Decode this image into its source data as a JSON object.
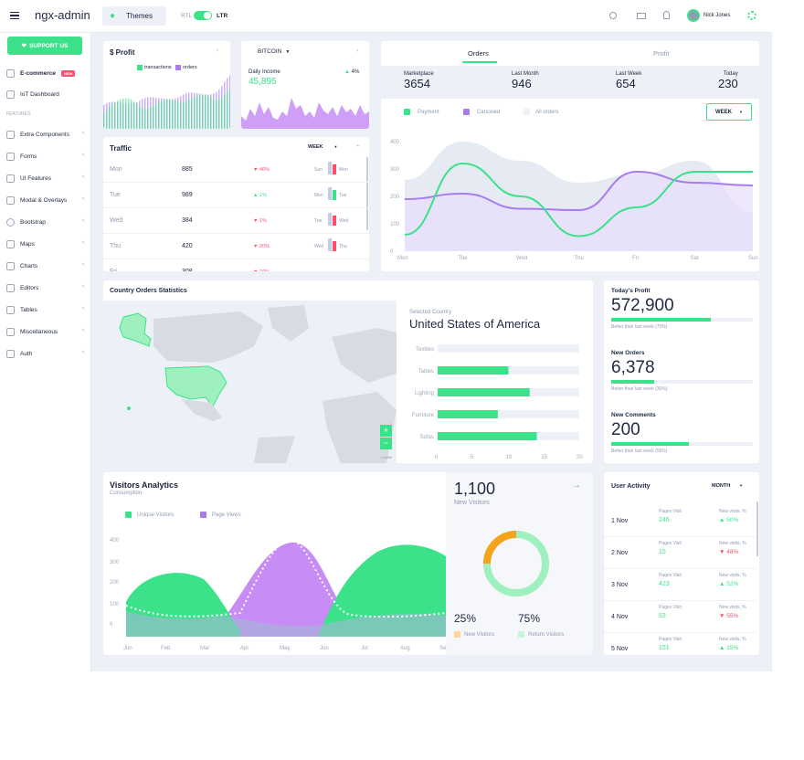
{
  "header": {
    "brand": "ngx-admin",
    "theme_label": "Themes",
    "rtl": "RTL",
    "ltr": "LTR",
    "user_name": "Nick Jones"
  },
  "sidebar": {
    "support": "SUPPORT US",
    "items": [
      {
        "label": "E-commerce",
        "badge": "NEW"
      },
      {
        "label": "IoT Dashboard"
      },
      {
        "label": "FEATURES"
      },
      {
        "label": "Extra Components"
      },
      {
        "label": "Forms"
      },
      {
        "label": "UI Features"
      },
      {
        "label": "Modal & Overlays"
      },
      {
        "label": "Bootstrap"
      },
      {
        "label": "Maps"
      },
      {
        "label": "Charts"
      },
      {
        "label": "Editors"
      },
      {
        "label": "Tables"
      },
      {
        "label": "Miscellaneous"
      },
      {
        "label": "Auth"
      }
    ]
  },
  "profit_card": {
    "title": "$  Profit",
    "legend": [
      "transactions",
      "orders"
    ]
  },
  "bitcoin_card": {
    "select": "BITCOIN",
    "label": "Daily Income",
    "value": "45,895",
    "change": "4%"
  },
  "orders_card": {
    "tabs": [
      "Orders",
      "Profit"
    ],
    "stats": [
      {
        "label": "Marketplace",
        "value": "3654"
      },
      {
        "label": "Last Month",
        "value": "946"
      },
      {
        "label": "Last Week",
        "value": "654"
      },
      {
        "label": "Today",
        "value": "230"
      }
    ],
    "legend": [
      "Payment",
      "Canceled",
      "All orders"
    ],
    "select": "WEEK",
    "chart_data": {
      "type": "area",
      "x": [
        "Mon",
        "Tue",
        "Wed",
        "Thu",
        "Fri",
        "Sat",
        "Sun"
      ],
      "ylim": [
        0,
        400
      ],
      "yticks": [
        "400",
        "300",
        "200",
        "100",
        "0"
      ],
      "series": [
        {
          "name": "Payment",
          "values": [
            60,
            320,
            200,
            55,
            160,
            290,
            290
          ]
        },
        {
          "name": "Canceled",
          "values": [
            190,
            210,
            155,
            150,
            290,
            250,
            240
          ]
        },
        {
          "name": "All orders",
          "values": [
            260,
            400,
            330,
            250,
            280,
            330,
            140
          ]
        }
      ]
    }
  },
  "traffic_card": {
    "title": "Traffic",
    "select": "WEEK",
    "rows": [
      {
        "day": "Mon",
        "value": "885",
        "delta": "46%",
        "dir": "down",
        "cmp": "Sun",
        "cmp2": "Mon"
      },
      {
        "day": "Tue",
        "value": "989",
        "delta": "1%",
        "dir": "up",
        "cmp": "Mon",
        "cmp2": "Tue"
      },
      {
        "day": "Wed",
        "value": "384",
        "delta": "1%",
        "dir": "down",
        "cmp": "Tue",
        "cmp2": "Wed"
      },
      {
        "day": "Thu",
        "value": "420",
        "delta": "20%",
        "dir": "down",
        "cmp": "Wed",
        "cmp2": "Thu"
      },
      {
        "day": "Fri",
        "value": "308",
        "delta": "10%",
        "dir": "down",
        "cmp": "",
        "cmp2": ""
      }
    ]
  },
  "country_card": {
    "title": "Country Orders Statistics",
    "selected_label": "Selected Country",
    "country": "United States of America",
    "legend": "Leaflet",
    "chart_data": {
      "type": "bar",
      "categories": [
        "Textiles",
        "Tables",
        "Lighting",
        "Furniture",
        "Sofas"
      ],
      "values": [
        0,
        10,
        13,
        8.5,
        14
      ],
      "xlim": [
        0,
        20
      ],
      "xticks": [
        "0",
        "5",
        "10",
        "15",
        "20"
      ]
    }
  },
  "stats_card": {
    "items": [
      {
        "label": "Today's Profit",
        "value": "572,900",
        "note": "Better than last week (70%)",
        "pct": 0.7
      },
      {
        "label": "New Orders",
        "value": "6,378",
        "note": "Better than last week (30%)",
        "pct": 0.3
      },
      {
        "label": "New Comments",
        "value": "200",
        "note": "Better than last week (55%)",
        "pct": 0.55
      }
    ]
  },
  "visitors_card": {
    "title": "Visitors Analytics",
    "subtitle": "Consumption",
    "legend": [
      "Unique Visitors",
      "Page Views"
    ],
    "yticks": [
      "400",
      "300",
      "200",
      "100",
      "0"
    ],
    "months": [
      "Jun",
      "Feb",
      "Mar",
      "Apr",
      "May",
      "Jun",
      "Jul",
      "Aug",
      "Sep"
    ],
    "big_value": "1,100",
    "big_label": "New Visitors",
    "pct1": "25%",
    "pct2": "75%",
    "leg1": "New Visitors",
    "leg2": "Return Visitors"
  },
  "activity_card": {
    "title": "User Activity",
    "select": "MONTH",
    "rows": [
      {
        "date": "1 Nov",
        "pv": "246",
        "nv": "50%",
        "dir": "up"
      },
      {
        "date": "2 Nov",
        "pv": "15",
        "nv": "48%",
        "dir": "down"
      },
      {
        "date": "3 Nov",
        "pv": "423",
        "nv": "52%",
        "dir": "up"
      },
      {
        "date": "4 Nov",
        "pv": "53",
        "nv": "55%",
        "dir": "down"
      },
      {
        "date": "5 Nov",
        "pv": "151",
        "nv": "15%",
        "dir": "up"
      }
    ],
    "pv_label": "Pages Visit",
    "nv_label": "New visits, %"
  },
  "colors": {
    "green": "#3ce28a",
    "purple": "#a87cf0",
    "red": "#ff4d6a"
  }
}
